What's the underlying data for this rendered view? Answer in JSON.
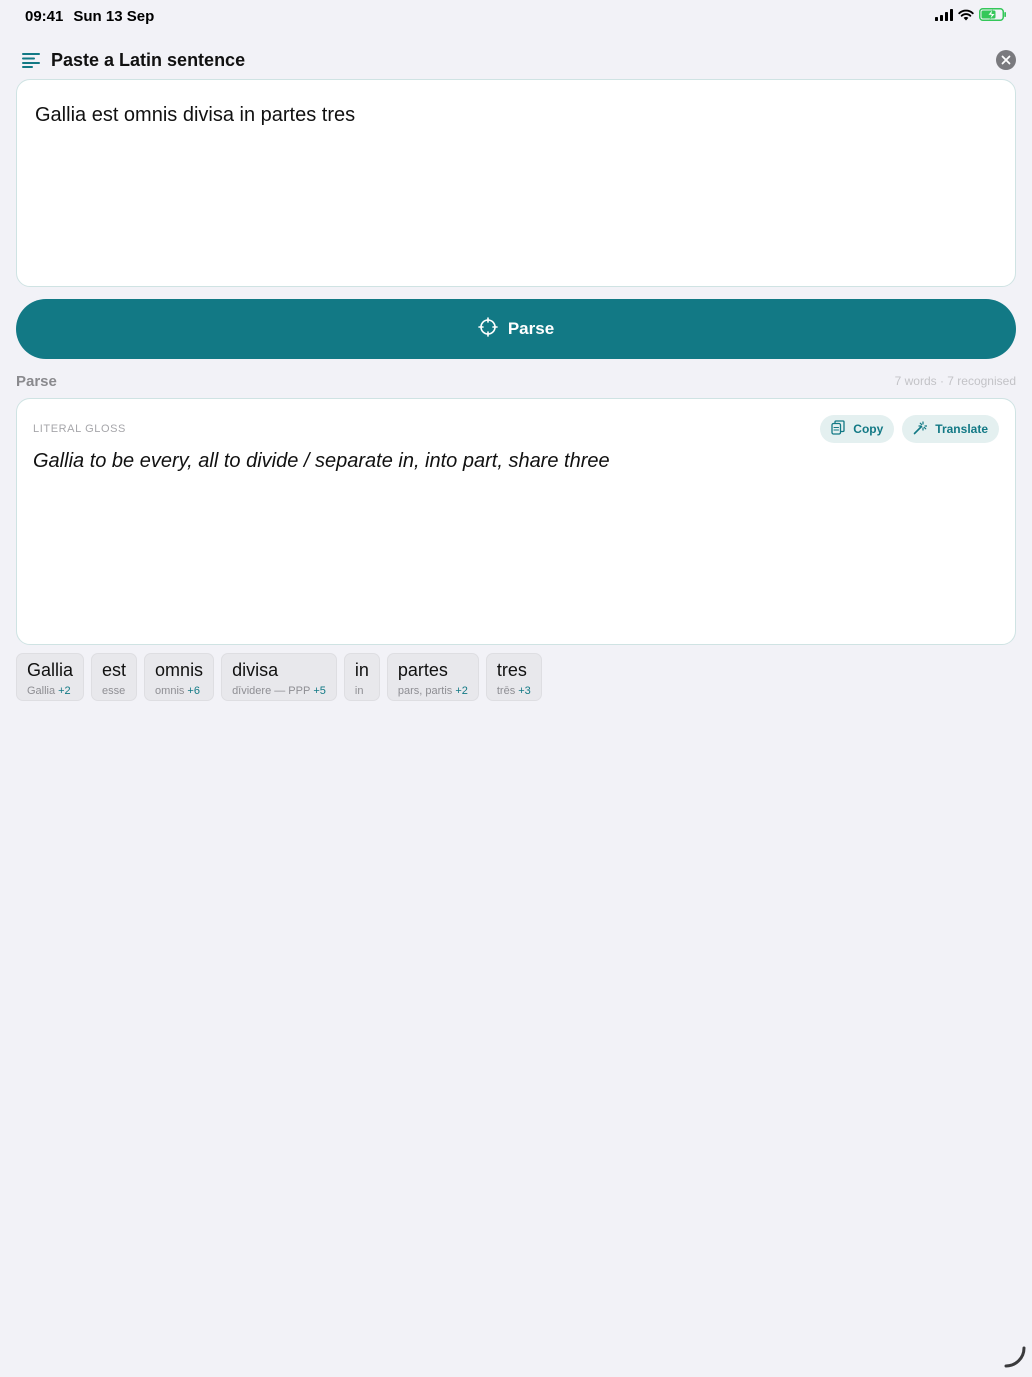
{
  "status_bar": {
    "time": "09:41",
    "date": "Sun 13 Sep",
    "accent": "#34c759"
  },
  "header": {
    "title": "Paste a Latin sentence",
    "menu_icon": "list-icon",
    "close_icon": "close-circle-icon"
  },
  "input": {
    "value": "Gallia est omnis divisa in partes tres"
  },
  "parse_button": {
    "label": "Parse",
    "icon": "crosshair-icon",
    "color": "#127985"
  },
  "results": {
    "section_title": "Parse",
    "meta": "7 words · 7 recognised",
    "gloss_label": "LITERAL GLOSS",
    "copy_label": "Copy",
    "translate_label": "Translate",
    "gloss_text": "Gallia to be every, all to divide / separate in, into part, share three"
  },
  "chips": [
    {
      "word": "Gallia",
      "lemma": "Gallia",
      "extra": "+2"
    },
    {
      "word": "est",
      "lemma": "esse",
      "extra": ""
    },
    {
      "word": "omnis",
      "lemma": "omnis",
      "extra": "+6"
    },
    {
      "word": "divisa",
      "lemma": "dīvidere — PPP",
      "extra": "+5"
    },
    {
      "word": "in",
      "lemma": "in",
      "extra": ""
    },
    {
      "word": "partes",
      "lemma": "pars, partis",
      "extra": "+2"
    },
    {
      "word": "tres",
      "lemma": "trēs",
      "extra": "+3"
    }
  ]
}
